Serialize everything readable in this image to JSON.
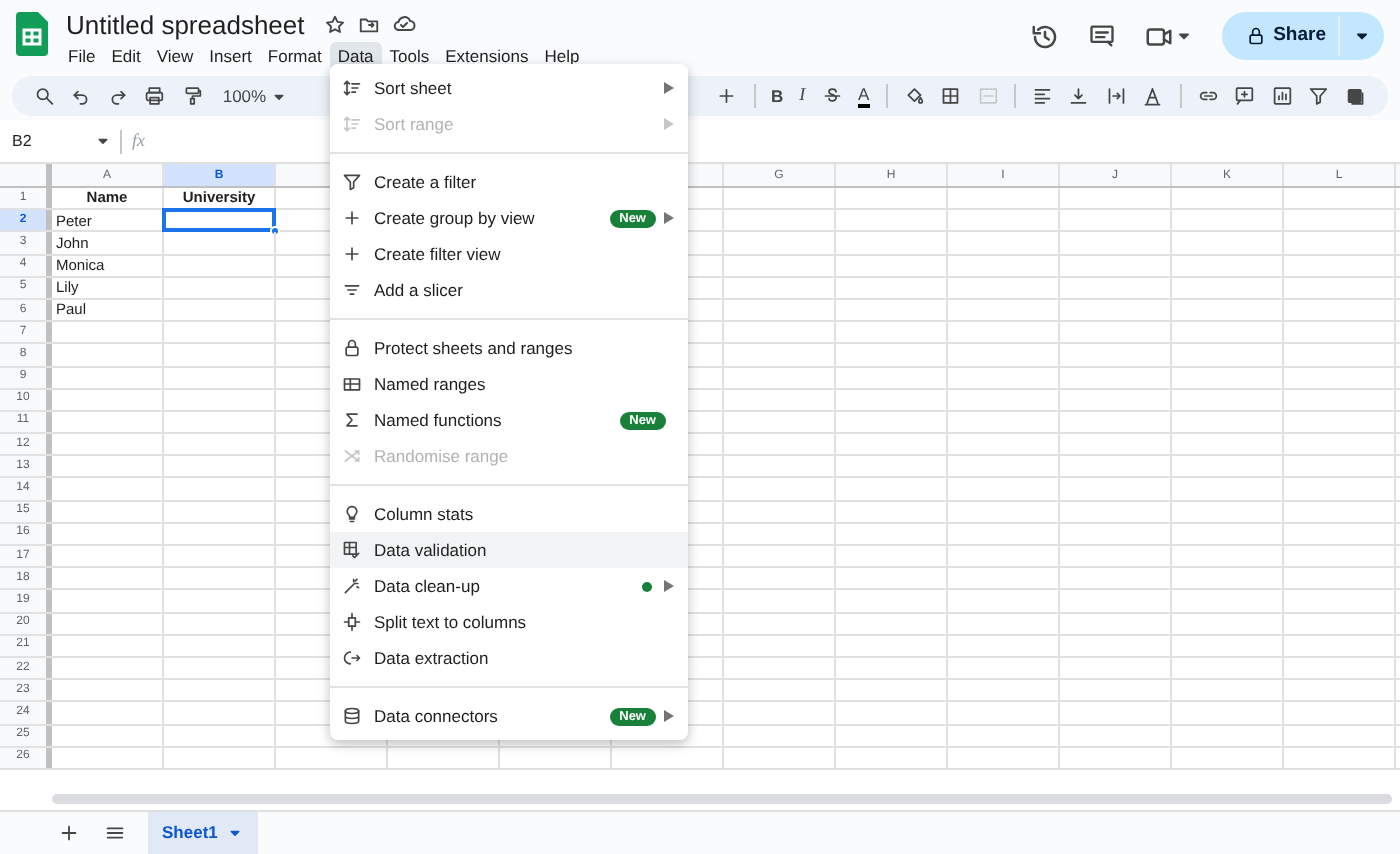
{
  "document": {
    "title": "Untitled spreadsheet"
  },
  "menu_bar": [
    {
      "label": "File",
      "selected": false
    },
    {
      "label": "Edit",
      "selected": false
    },
    {
      "label": "View",
      "selected": false
    },
    {
      "label": "Insert",
      "selected": false
    },
    {
      "label": "Format",
      "selected": false
    },
    {
      "label": "Data",
      "selected": true
    },
    {
      "label": "Tools",
      "selected": false
    },
    {
      "label": "Extensions",
      "selected": false
    },
    {
      "label": "Help",
      "selected": false
    }
  ],
  "share_button": {
    "label": "Share"
  },
  "toolbar": {
    "zoom": "100%",
    "bold": "B",
    "italic": "I",
    "text_color": "A"
  },
  "name_box": "B2",
  "formula_icon": "fx",
  "columns": [
    {
      "label": "A",
      "selected": false
    },
    {
      "label": "B",
      "selected": true
    },
    {
      "label": "G",
      "selected": false
    },
    {
      "label": "H",
      "selected": false
    },
    {
      "label": "I",
      "selected": false
    },
    {
      "label": "J",
      "selected": false
    },
    {
      "label": "K",
      "selected": false
    },
    {
      "label": "L",
      "selected": false
    }
  ],
  "rows": [
    {
      "number": "1",
      "selected": false,
      "kind": "header",
      "cells": [
        "Name",
        "University"
      ]
    },
    {
      "number": "2",
      "selected": true,
      "cells": [
        "Peter"
      ]
    },
    {
      "number": "3",
      "selected": false,
      "cells": [
        "John"
      ]
    },
    {
      "number": "4",
      "selected": false,
      "cells": [
        "Monica"
      ]
    },
    {
      "number": "5",
      "selected": false,
      "cells": [
        "Lily"
      ]
    },
    {
      "number": "6",
      "selected": false,
      "cells": [
        "Paul"
      ]
    },
    {
      "number": "7",
      "selected": false
    },
    {
      "number": "8",
      "selected": false
    },
    {
      "number": "9",
      "selected": false
    },
    {
      "number": "10",
      "selected": false
    },
    {
      "number": "11",
      "selected": false
    },
    {
      "number": "12",
      "selected": false
    },
    {
      "number": "13",
      "selected": false
    },
    {
      "number": "14",
      "selected": false
    },
    {
      "number": "15",
      "selected": false
    },
    {
      "number": "16",
      "selected": false
    },
    {
      "number": "17",
      "selected": false
    },
    {
      "number": "18",
      "selected": false
    },
    {
      "number": "19",
      "selected": false
    },
    {
      "number": "20",
      "selected": false
    },
    {
      "number": "21",
      "selected": false
    },
    {
      "number": "22",
      "selected": false
    },
    {
      "number": "23",
      "selected": false
    },
    {
      "number": "24",
      "selected": false
    },
    {
      "number": "25",
      "selected": false
    },
    {
      "number": "26",
      "selected": false
    }
  ],
  "data_menu": {
    "sections": [
      [
        {
          "label": "Sort sheet",
          "disabled": false,
          "selected": false,
          "submenu": true
        },
        {
          "label": "Sort range",
          "disabled": true,
          "selected": false,
          "submenu": true
        }
      ],
      [
        {
          "label": "Create a filter",
          "disabled": false,
          "selected": false,
          "submenu": false
        },
        {
          "label": "Create group by view",
          "disabled": false,
          "selected": false,
          "submenu": true,
          "badge": "New"
        },
        {
          "label": "Create filter view",
          "disabled": false,
          "selected": false,
          "submenu": false
        },
        {
          "label": "Add a slicer",
          "disabled": false,
          "selected": false,
          "submenu": false
        }
      ],
      [
        {
          "label": "Protect sheets and ranges",
          "disabled": false,
          "selected": false,
          "submenu": false
        },
        {
          "label": "Named ranges",
          "disabled": false,
          "selected": false,
          "submenu": false
        },
        {
          "label": "Named functions",
          "disabled": false,
          "selected": false,
          "submenu": false,
          "badge": "New"
        },
        {
          "label": "Randomise range",
          "disabled": true,
          "selected": false,
          "submenu": false
        }
      ],
      [
        {
          "label": "Column stats",
          "disabled": false,
          "selected": false,
          "submenu": false
        },
        {
          "label": "Data validation",
          "disabled": false,
          "selected": true,
          "submenu": false
        },
        {
          "label": "Data clean-up",
          "disabled": false,
          "selected": false,
          "submenu": true,
          "color": "#188038"
        },
        {
          "label": "Split text to columns",
          "disabled": false,
          "selected": false,
          "submenu": false
        },
        {
          "label": "Data extraction",
          "disabled": false,
          "selected": false,
          "submenu": false
        }
      ],
      [
        {
          "label": "Data connectors",
          "disabled": false,
          "selected": false,
          "submenu": true,
          "badge": "New"
        }
      ]
    ]
  },
  "sheet_tabs": [
    {
      "label": "Sheet1",
      "selected": true
    }
  ]
}
